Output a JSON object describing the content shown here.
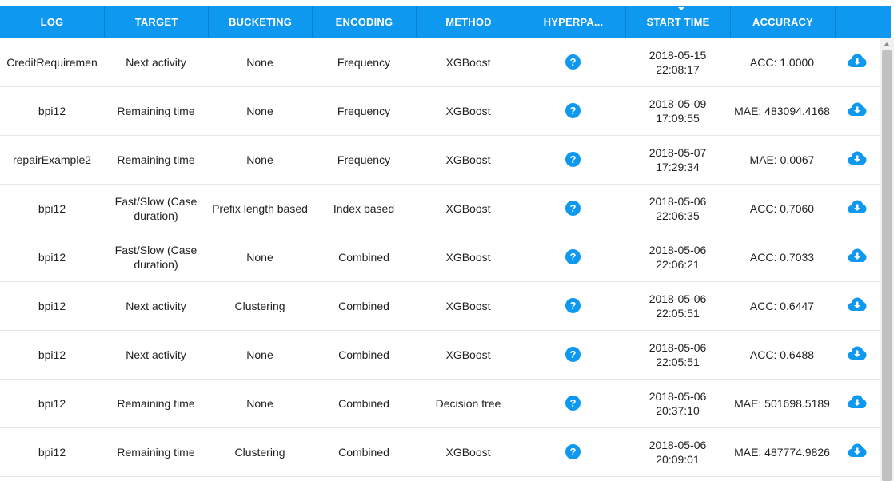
{
  "table": {
    "columns": [
      {
        "key": "log",
        "label": "LOG"
      },
      {
        "key": "target",
        "label": "TARGET"
      },
      {
        "key": "bucketing",
        "label": "BUCKETING"
      },
      {
        "key": "encoding",
        "label": "ENCODING"
      },
      {
        "key": "method",
        "label": "METHOD"
      },
      {
        "key": "hyperparams",
        "label": "HYPERPA..."
      },
      {
        "key": "start_time",
        "label": "START TIME",
        "sorted": "desc"
      },
      {
        "key": "accuracy",
        "label": "ACCURACY"
      },
      {
        "key": "download",
        "label": ""
      }
    ],
    "rows": [
      {
        "log": "CreditRequiremen",
        "target": "Next activity",
        "bucketing": "None",
        "encoding": "Frequency",
        "method": "XGBoost",
        "start_time": "2018-05-15 22:08:17",
        "accuracy": "ACC: 1.0000"
      },
      {
        "log": "bpi12",
        "target": "Remaining time",
        "bucketing": "None",
        "encoding": "Frequency",
        "method": "XGBoost",
        "start_time": "2018-05-09 17:09:55",
        "accuracy": "MAE: 483094.4168"
      },
      {
        "log": "repairExample2",
        "target": "Remaining time",
        "bucketing": "None",
        "encoding": "Frequency",
        "method": "XGBoost",
        "start_time": "2018-05-07 17:29:34",
        "accuracy": "MAE: 0.0067"
      },
      {
        "log": "bpi12",
        "target": "Fast/Slow (Case duration)",
        "bucketing": "Prefix length based",
        "encoding": "Index based",
        "method": "XGBoost",
        "start_time": "2018-05-06 22:06:35",
        "accuracy": "ACC: 0.7060"
      },
      {
        "log": "bpi12",
        "target": "Fast/Slow (Case duration)",
        "bucketing": "None",
        "encoding": "Combined",
        "method": "XGBoost",
        "start_time": "2018-05-06 22:06:21",
        "accuracy": "ACC: 0.7033"
      },
      {
        "log": "bpi12",
        "target": "Next activity",
        "bucketing": "Clustering",
        "encoding": "Combined",
        "method": "XGBoost",
        "start_time": "2018-05-06 22:05:51",
        "accuracy": "ACC: 0.6447"
      },
      {
        "log": "bpi12",
        "target": "Next activity",
        "bucketing": "None",
        "encoding": "Combined",
        "method": "XGBoost",
        "start_time": "2018-05-06 22:05:51",
        "accuracy": "ACC: 0.6488"
      },
      {
        "log": "bpi12",
        "target": "Remaining time",
        "bucketing": "None",
        "encoding": "Combined",
        "method": "Decision tree",
        "start_time": "2018-05-06 20:37:10",
        "accuracy": "MAE: 501698.5189"
      },
      {
        "log": "bpi12",
        "target": "Remaining time",
        "bucketing": "Clustering",
        "encoding": "Combined",
        "method": "XGBoost",
        "start_time": "2018-05-06 20:09:01",
        "accuracy": "MAE: 487774.9826"
      }
    ]
  },
  "icons": {
    "help": "question-icon",
    "help_glyph": "?",
    "download": "cloud-download-icon"
  },
  "colors": {
    "accent": "#0e98f0",
    "header_text": "#ffffff",
    "row_divider": "#e6e6e6",
    "text": "#222222"
  }
}
